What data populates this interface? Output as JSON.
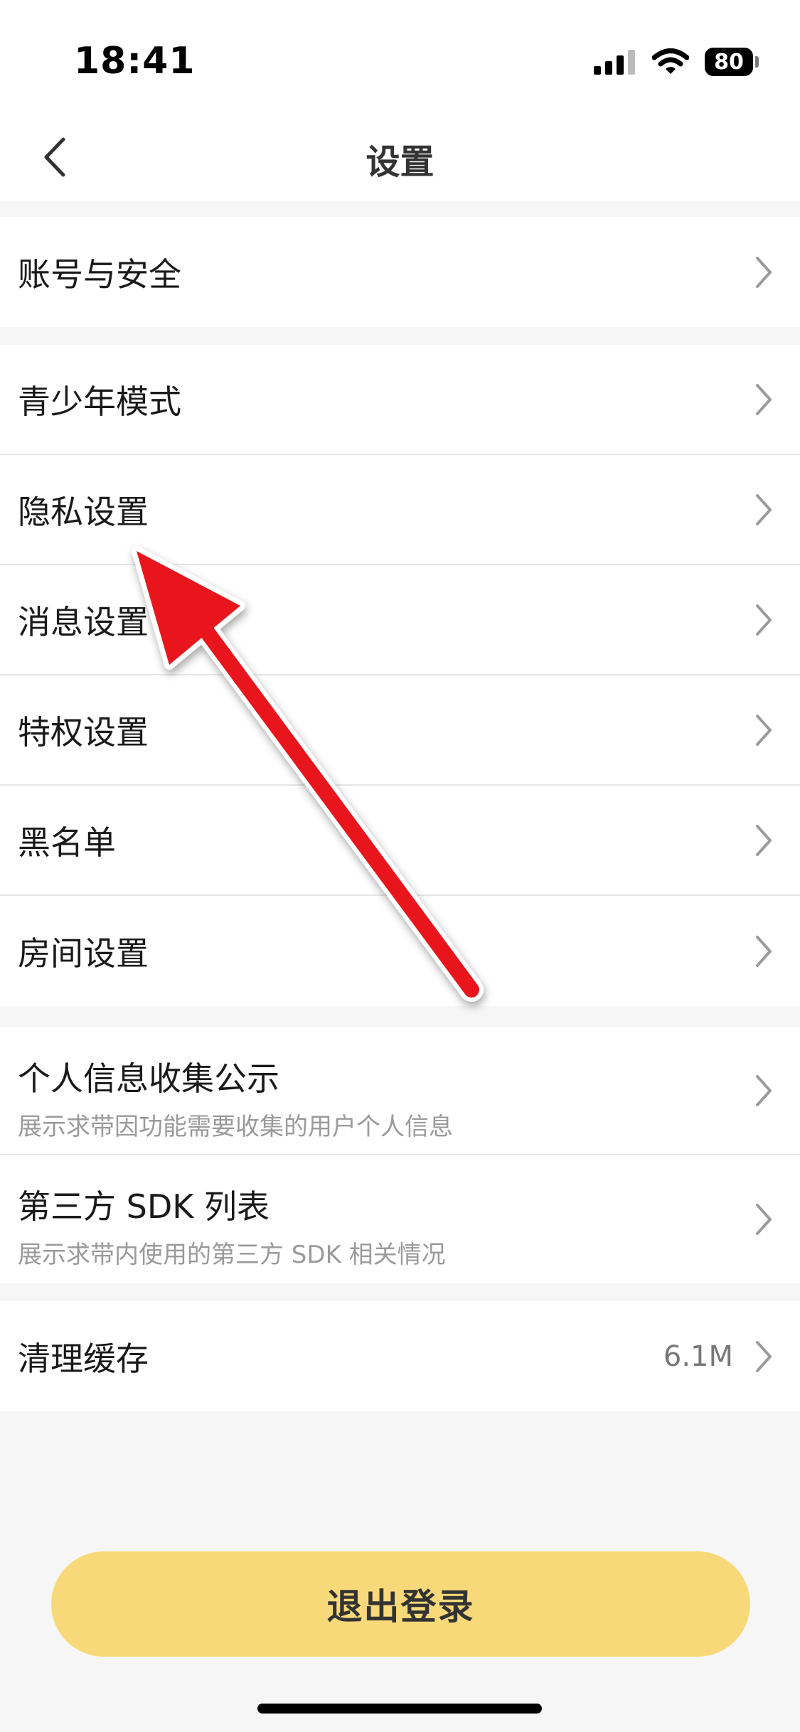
{
  "status_bar": {
    "time": "18:41",
    "battery_level": "80",
    "icons": [
      "signal-icon",
      "wifi-icon",
      "battery-icon"
    ]
  },
  "nav": {
    "title": "设置",
    "back_icon": "chevron-left-icon"
  },
  "groups": [
    {
      "items": [
        {
          "label": "账号与安全"
        }
      ]
    },
    {
      "items": [
        {
          "label": "青少年模式"
        },
        {
          "label": "隐私设置"
        },
        {
          "label": "消息设置"
        },
        {
          "label": "特权设置"
        },
        {
          "label": "黑名单"
        },
        {
          "label": "房间设置"
        }
      ]
    },
    {
      "items": [
        {
          "label": "个人信息收集公示",
          "subtitle": "展示求带因功能需要收集的用户个人信息"
        },
        {
          "label": "第三方 SDK 列表",
          "subtitle": "展示求带内使用的第三方 SDK 相关情况"
        }
      ]
    },
    {
      "items": [
        {
          "label": "清理缓存",
          "value": "6.1M"
        }
      ]
    }
  ],
  "logout_button": {
    "label": "退出登录"
  },
  "colors": {
    "accent_button": "#f8d97a",
    "annotation_arrow": "#e8141e",
    "page_background": "#f6f6f6"
  }
}
